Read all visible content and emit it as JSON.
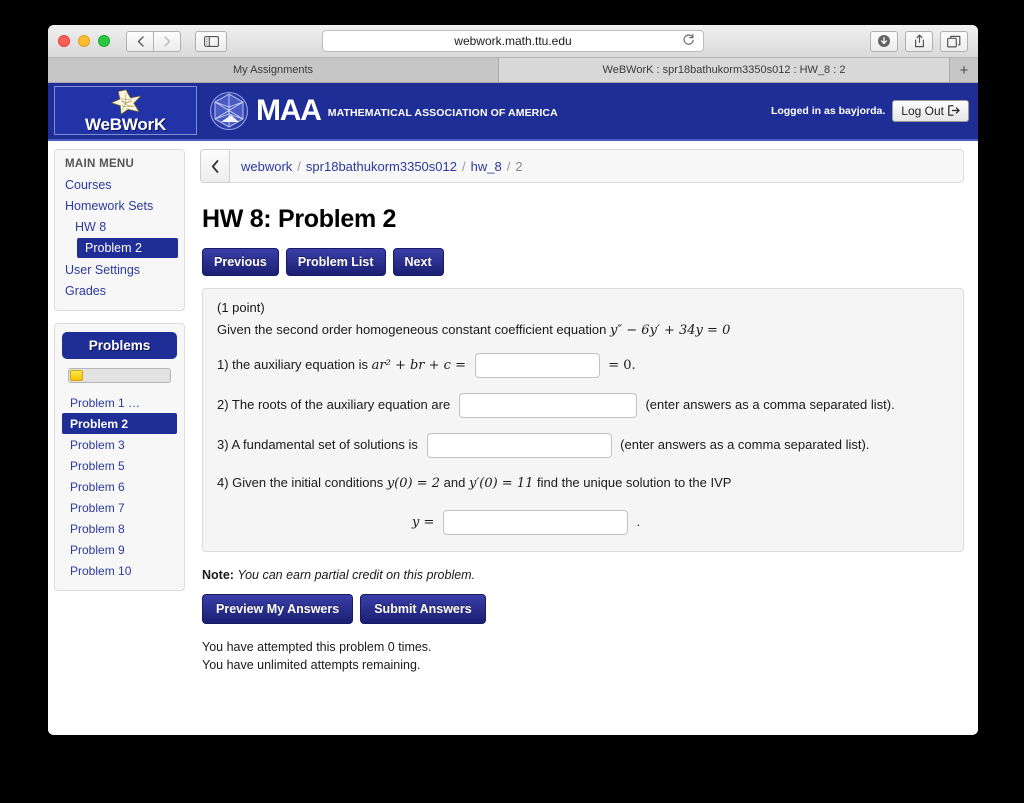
{
  "browser": {
    "url": "webwork.math.ttu.edu",
    "reload_icon": "reload-icon",
    "back_icon": "chevron-left-icon",
    "forward_icon": "chevron-right-icon",
    "sidebar_icon": "sidebar-panel-icon",
    "download_icon": "download-circle-icon",
    "share_icon": "share-upload-icon",
    "tabs_icon": "show-tabs-icon",
    "new_tab_label": "+",
    "tabs": [
      {
        "label": "My Assignments",
        "active": false
      },
      {
        "label": "WeBWorK : spr18bathukorm3350s012 : HW_8 : 2",
        "active": true
      }
    ]
  },
  "masthead": {
    "wordmark": "WeBWorK",
    "star_icon": "webwork-star-icon",
    "maa_icon": "maa-polyhedron-icon",
    "maa_text": "MAA",
    "maa_subtitle": "MATHEMATICAL ASSOCIATION OF AMERICA",
    "login_text": "Logged in as bayjorda.",
    "logout_label": "Log Out",
    "logout_icon": "logout-arrow-icon"
  },
  "sidebar": {
    "main_menu_title": "MAIN MENU",
    "menu_items": [
      {
        "label": "Courses",
        "indent": 0,
        "current": false
      },
      {
        "label": "Homework Sets",
        "indent": 0,
        "current": false
      },
      {
        "label": "HW 8",
        "indent": 1,
        "current": false
      },
      {
        "label": "Problem 2",
        "indent": 2,
        "current": true
      },
      {
        "label": "User Settings",
        "indent": 0,
        "current": false
      },
      {
        "label": "Grades",
        "indent": 0,
        "current": false
      }
    ],
    "problems_header": "Problems",
    "progress_percent": 13,
    "problems": [
      {
        "label": "Problem 1 …",
        "current": false
      },
      {
        "label": "Problem 2",
        "current": true
      },
      {
        "label": "Problem 3",
        "current": false
      },
      {
        "label": "Problem 5",
        "current": false
      },
      {
        "label": "Problem 6",
        "current": false
      },
      {
        "label": "Problem 7",
        "current": false
      },
      {
        "label": "Problem 8",
        "current": false
      },
      {
        "label": "Problem 9",
        "current": false
      },
      {
        "label": "Problem 10",
        "current": false
      }
    ]
  },
  "main": {
    "back_icon": "chevron-left-icon",
    "breadcrumb": [
      "webwork",
      "spr18bathukorm3350s012",
      "hw_8",
      "2"
    ],
    "page_title": "HW 8: Problem 2",
    "nav_buttons": [
      "Previous",
      "Problem List",
      "Next"
    ],
    "problem": {
      "points": "(1 point)",
      "intro_text": "Given the second order homogeneous constant coefficient equation",
      "equation": "y″ − 6y′ + 34y = 0",
      "q1_prefix": "1) the auxiliary equation is",
      "q1_math": "ar² + br + c =",
      "q1_suffix": "= 0.",
      "q2_text": "2) The roots of the auxiliary equation are",
      "q2_suffix": "(enter answers as a comma separated list).",
      "q3_text": "3) A fundamental set of solutions is",
      "q3_suffix": "(enter answers as a comma separated list).",
      "q4_prefix": "4) Given the initial conditions",
      "q4_cond1": "y(0) = 2",
      "q4_and": "and",
      "q4_cond2": "y′(0) = 11",
      "q4_suffix": "find the unique solution to the IVP",
      "q4_y_label": "y =",
      "q4_period": ".",
      "answer_values": [
        "",
        "",
        "",
        ""
      ]
    },
    "note_label": "Note:",
    "note_text": "You can earn partial credit on this problem.",
    "submit_buttons": [
      "Preview My Answers",
      "Submit Answers"
    ],
    "attempts_line1": "You have attempted this problem 0 times.",
    "attempts_line2": "You have unlimited attempts remaining."
  },
  "colors": {
    "webwork_navy": "#1f2e96",
    "link_blue": "#2b3aa0",
    "progress_yellow": "#f5c400"
  }
}
